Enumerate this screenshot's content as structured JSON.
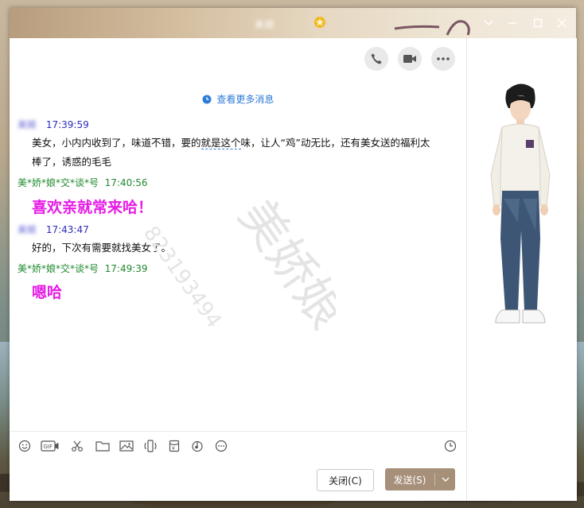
{
  "window": {
    "title": "美姬",
    "controls": {
      "skin": "chevron-down-icon",
      "minimize": "minimize-icon",
      "maximize": "maximize-icon",
      "close": "close-icon"
    }
  },
  "header_actions": [
    "phone-icon",
    "video-call-icon",
    "more-icon"
  ],
  "history_link": "查看更多消息",
  "messages": [
    {
      "sender": "美姬",
      "time": "17:39:59",
      "text_a": "美女，小内内收到了，味道不错，要的",
      "text_underlined": "就是这个",
      "text_b": "味，让人“鸡”动无比，还有美女送的福利太",
      "text_c": "棒了，诱惑的毛毛",
      "sender_color": "#2a2ac0"
    },
    {
      "sender": "美*娇*娘*交*谈*号",
      "time": "17:40:56",
      "text": "喜欢亲就常来哈！",
      "sender_color": "#1f8a2e",
      "text_color": "#e61be6"
    },
    {
      "sender": "美姬",
      "time": "17:43:47",
      "text": "好的，下次有需要就找美女了。",
      "sender_color": "#2a2ac0"
    },
    {
      "sender": "美*娇*娘*交*谈*号",
      "time": "17:49:39",
      "text": "嗯哈",
      "sender_color": "#1f8a2e",
      "text_color": "#e61be6"
    }
  ],
  "watermark": {
    "text": "美娇娘",
    "number": "823193494"
  },
  "toolbar": [
    "emoji-icon",
    "gif-icon",
    "scissors-icon",
    "folder-icon",
    "image-icon",
    "shake-icon",
    "red-packet-icon",
    "music-icon",
    "more-icon",
    "history-clock-icon"
  ],
  "buttons": {
    "close_label": "关闭(C)",
    "send_label": "发送(S)"
  },
  "colors": {
    "accent": "#2d7bd8",
    "send_button": "#a7907a",
    "pink": "#e61be6",
    "green": "#1f8a2e",
    "blue_time": "#2a2ac0"
  }
}
